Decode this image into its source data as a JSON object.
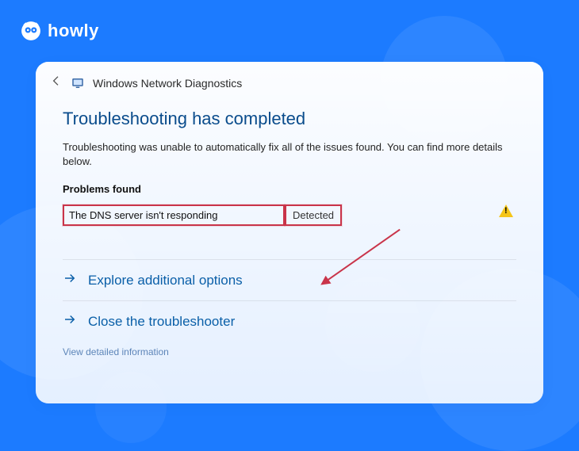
{
  "brand": {
    "name": "howly"
  },
  "window": {
    "title": "Windows Network Diagnostics"
  },
  "heading": "Troubleshooting has completed",
  "subtext": "Troubleshooting was unable to automatically fix all of the issues found. You can find more details below.",
  "problems": {
    "section_label": "Problems found",
    "items": [
      {
        "name": "The DNS server isn't responding",
        "status": "Detected"
      }
    ]
  },
  "options": {
    "explore": "Explore additional options",
    "close": "Close the troubleshooter"
  },
  "detail_link": "View detailed information",
  "colors": {
    "accent_blue": "#1c7bff",
    "heading_blue": "#0a4c8c",
    "link_blue": "#0a5fa8",
    "highlight_red": "#c9344a",
    "warn_yellow": "#f5c518"
  }
}
